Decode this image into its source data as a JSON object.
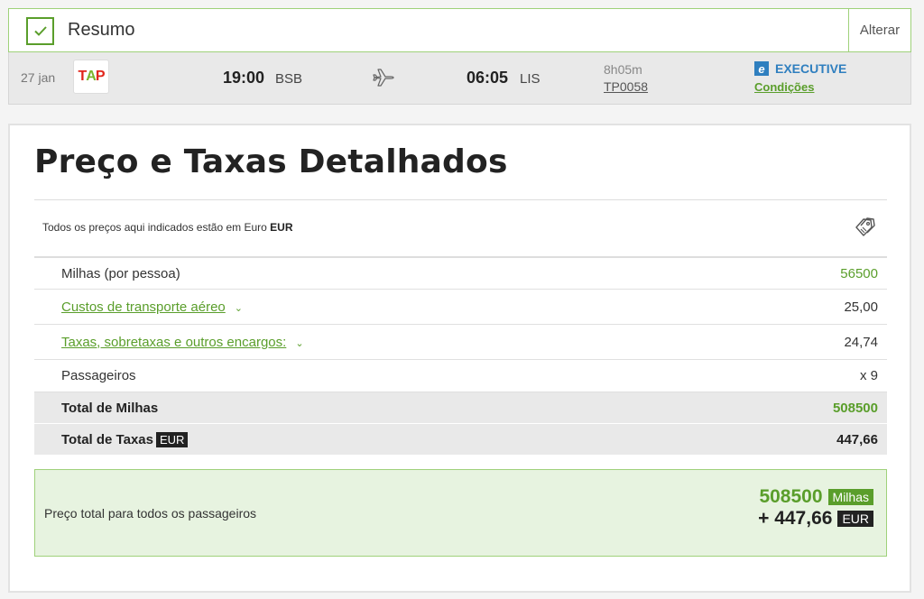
{
  "summary": {
    "title": "Resumo",
    "change_label": "Alterar"
  },
  "flight": {
    "date": "27 jan",
    "airline_logo_text": "TAP",
    "departure_time": "19:00",
    "departure_code": "BSB",
    "arrival_time": "06:05",
    "arrival_code": "LIS",
    "duration": "8h05m",
    "flight_number": "TP0058",
    "cabin_badge": "e",
    "cabin_class": "EXECUTIVE",
    "conditions_label": "Condições"
  },
  "pricing": {
    "title": "Preço e Taxas Detalhados",
    "currency_note_prefix": "Todos os preços aqui indicados estão em Euro ",
    "currency_note_code": "EUR",
    "rows": [
      {
        "label": "Milhas (por pessoa)",
        "value": "56500"
      },
      {
        "label": "Custos de transporte aéreo",
        "value": "25,00"
      },
      {
        "label": "Taxas, sobretaxas e outros encargos:",
        "value": "24,74"
      },
      {
        "label": "Passageiros",
        "value": "x 9"
      }
    ],
    "total_miles_label": "Total de Milhas",
    "total_miles_value": "508500",
    "total_taxes_label": "Total de Taxas",
    "total_taxes_currency": "EUR",
    "total_taxes_value": "447,66"
  },
  "grand_total": {
    "label": "Preço total para todos os passageiros",
    "miles_value": "508500",
    "miles_unit": "Milhas",
    "money_value": "+ 447,66",
    "money_unit": "EUR"
  },
  "colors": {
    "accent_green": "#5a9e2b",
    "border_green": "#9fd17a",
    "executive_blue": "#2f7fbf",
    "tap_red": "#e1251b"
  }
}
